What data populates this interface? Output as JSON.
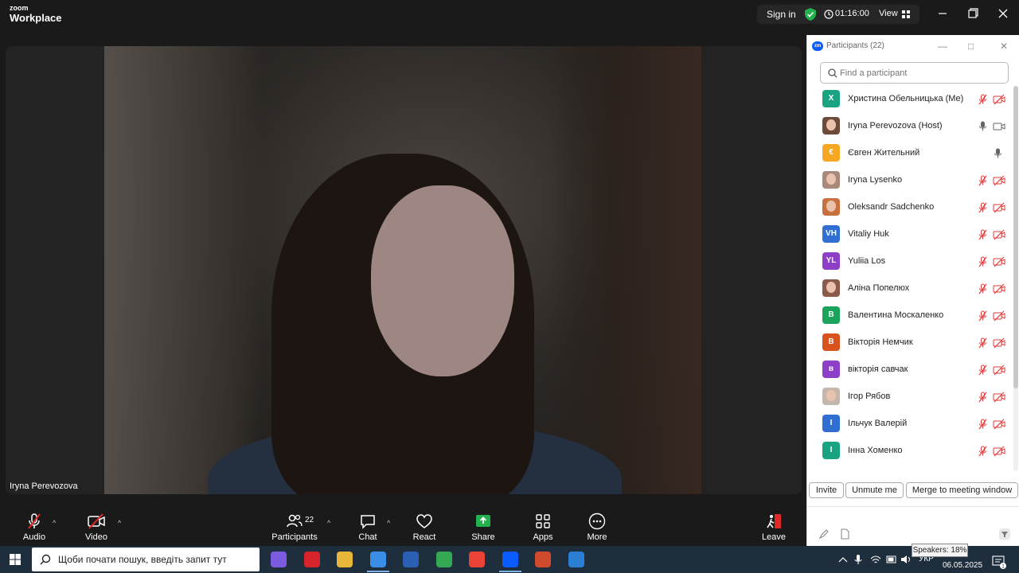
{
  "app": {
    "logo_line1": "zoom",
    "logo_line2": "Workplace"
  },
  "topbar": {
    "sign_in": "Sign in",
    "timer": "01:16:00",
    "view": "View"
  },
  "video": {
    "speaker_label": "Iryna Perevozova"
  },
  "toolbar": {
    "audio": "Audio",
    "video": "Video",
    "participants": "Participants",
    "participants_count": "22",
    "chat": "Chat",
    "react": "React",
    "share": "Share",
    "apps": "Apps",
    "more": "More",
    "leave": "Leave"
  },
  "panel": {
    "badge": "zm",
    "title": "Participants (22)",
    "search_placeholder": "Find a participant",
    "buttons": {
      "invite": "Invite",
      "unmute_me": "Unmute me",
      "merge": "Merge to meeting window"
    },
    "participants": [
      {
        "name": "Христина Обельницька (Me)",
        "initials": "Х",
        "color": "#1aa381",
        "photo": false,
        "mic": "muted",
        "cam": "off"
      },
      {
        "name": "Iryna Perevozova (Host)",
        "initials": "",
        "color": "#6e4a3a",
        "photo": true,
        "mic": "on",
        "cam": "on"
      },
      {
        "name": "Євген Жительний",
        "initials": "€",
        "color": "#f5a623",
        "photo": false,
        "mic": "on",
        "cam": "none"
      },
      {
        "name": "Iryna Lysenko",
        "initials": "",
        "color": "#a98a7a",
        "photo": true,
        "mic": "muted",
        "cam": "off"
      },
      {
        "name": "Oleksandr Sadchenko",
        "initials": "",
        "color": "#c8713f",
        "photo": true,
        "mic": "muted",
        "cam": "off"
      },
      {
        "name": "Vitaliy Huk",
        "initials": "VH",
        "color": "#2e6fd1",
        "photo": false,
        "mic": "muted",
        "cam": "off"
      },
      {
        "name": "Yuliia Los",
        "initials": "YL",
        "color": "#8e3fc7",
        "photo": false,
        "mic": "muted",
        "cam": "off"
      },
      {
        "name": "Аліна Попелюх",
        "initials": "",
        "color": "#8a5a4a",
        "photo": true,
        "mic": "muted",
        "cam": "off"
      },
      {
        "name": "Валентина Москаленко",
        "initials": "В",
        "color": "#1aa35a",
        "photo": false,
        "mic": "muted",
        "cam": "off"
      },
      {
        "name": "Вікторія Немчик",
        "initials": "В",
        "color": "#d9531e",
        "photo": false,
        "mic": "muted",
        "cam": "off"
      },
      {
        "name": "вікторія савчак",
        "initials": "в",
        "color": "#8e3fc7",
        "photo": false,
        "mic": "muted",
        "cam": "off"
      },
      {
        "name": "Ігор Рябов",
        "initials": "",
        "color": "#c4b6aa",
        "photo": true,
        "mic": "muted",
        "cam": "off"
      },
      {
        "name": "Ільчук Валерій",
        "initials": "І",
        "color": "#2e6fd1",
        "photo": false,
        "mic": "muted",
        "cam": "off"
      },
      {
        "name": "Інна Хоменко",
        "initials": "І",
        "color": "#1aa381",
        "photo": false,
        "mic": "muted",
        "cam": "off"
      }
    ]
  },
  "taskbar": {
    "search_placeholder": "Щоби почати пошук, введіть запит тут",
    "apps": [
      {
        "name": "copilot",
        "color": "#7b5ce0"
      },
      {
        "name": "opera",
        "color": "#d8232a"
      },
      {
        "name": "file-explorer",
        "color": "#e8b73a"
      },
      {
        "name": "browser",
        "color": "#3a8ee6"
      },
      {
        "name": "word",
        "color": "#2b5fb4"
      },
      {
        "name": "chrome",
        "color": "#34a853"
      },
      {
        "name": "chrome-2",
        "color": "#ea4335"
      },
      {
        "name": "zoom",
        "color": "#0b5cff"
      },
      {
        "name": "media",
        "color": "#d04a2e"
      },
      {
        "name": "draw",
        "color": "#2a7fd4"
      }
    ],
    "tooltip": "Speakers: 18%",
    "language": "УКР",
    "date": "06.05.2025",
    "notifications": "1"
  }
}
